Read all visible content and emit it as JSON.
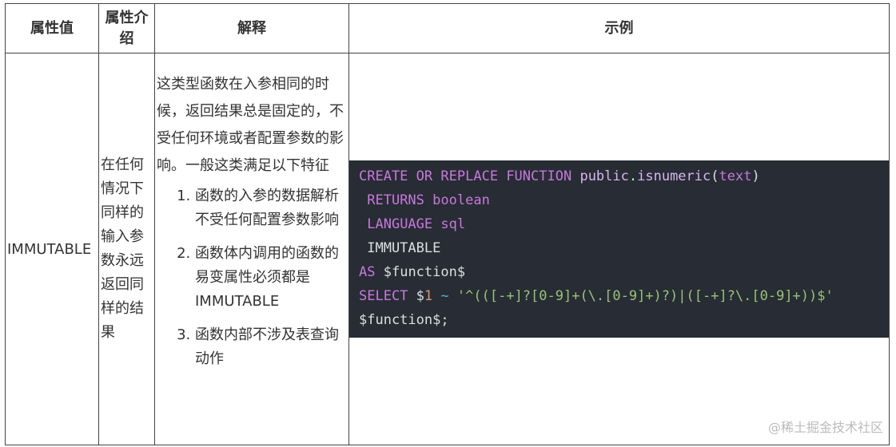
{
  "table": {
    "headers": [
      "属性值",
      "属性介绍",
      "解释",
      "示例"
    ],
    "row": {
      "value": "IMMUTABLE",
      "intro": "在任何情况下同样的输入参数永远返回同样的结果",
      "explain": "这类型函数在入参相同的时候，返回结果总是固定的，不受任何环境或者配置参数的影响。一般这类满足以下特征",
      "features": [
        "函数的入参的数据解析不受任何配置参数影响",
        "函数体内调用的函数的易变属性必须都是IMMUTABLE",
        "函数内部不涉及表查询动作"
      ]
    }
  },
  "code": {
    "l1_kw1": "CREATE",
    "l1_kw2": "OR",
    "l1_kw3": "REPLACE",
    "l1_kw4": "FUNCTION",
    "l1_schema": "public",
    "l1_dot": ".",
    "l1_fn": "isnumeric",
    "l1_open": "(",
    "l1_type": "text",
    "l1_close": ")",
    "l2_indent": " ",
    "l2_kw": "RETURNS",
    "l2_type": "boolean",
    "l3_indent": " ",
    "l3_kw": "LANGUAGE",
    "l3_val": "sql",
    "l4_text": " IMMUTABLE",
    "l5_kw": "AS",
    "l5_body": "$function$",
    "l6_kw": "SELECT",
    "l6_dollar": "$",
    "l6_num": "1",
    "l6_op": "~",
    "l6_str": "'^(([-+]?[0-9]+(\\.[0-9]+)?)|([-+]?\\.[0-9]+))$'",
    "l7_text": "$function$;"
  },
  "watermark": "@稀土掘金技术社区"
}
